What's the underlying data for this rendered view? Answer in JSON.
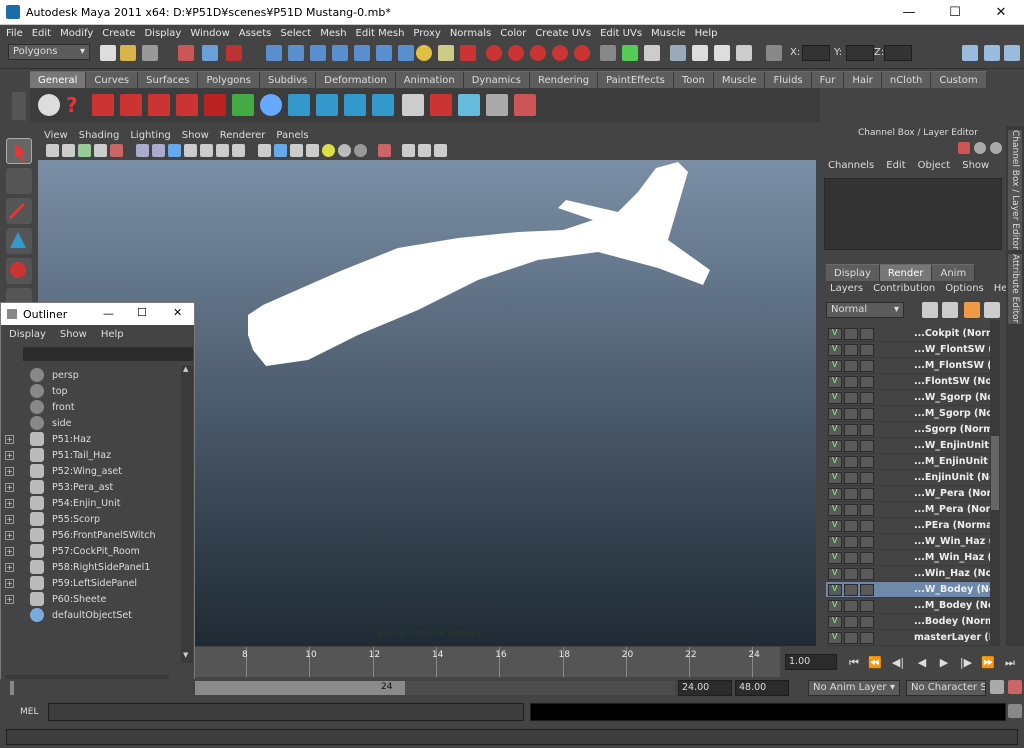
{
  "window": {
    "title": "Autodesk Maya 2011 x64: D:¥P51D¥scenes¥P51D Mustang-0.mb*",
    "minimize": "—",
    "maximize": "☐",
    "close": "✕"
  },
  "menubar": [
    "File",
    "Edit",
    "Modify",
    "Create",
    "Display",
    "Window",
    "Assets",
    "Select",
    "Mesh",
    "Edit Mesh",
    "Proxy",
    "Normals",
    "Color",
    "Create UVs",
    "Edit UVs",
    "Muscle",
    "Help"
  ],
  "statusline": {
    "mode": "Polygons",
    "x_label": "X:",
    "y_label": "Y:",
    "z_label": "Z:"
  },
  "shelf_tabs": [
    "General",
    "Curves",
    "Surfaces",
    "Polygons",
    "Subdivs",
    "Deformation",
    "Animation",
    "Dynamics",
    "Rendering",
    "PaintEffects",
    "Toon",
    "Muscle",
    "Fluids",
    "Fur",
    "Hair",
    "nCloth",
    "Custom"
  ],
  "viewport": {
    "menu": [
      "View",
      "Shading",
      "Lighting",
      "Show",
      "Renderer",
      "Panels"
    ],
    "camera_label": "persp (P51:W_Bodey)"
  },
  "channel_box": {
    "title": "Channel Box / Layer Editor",
    "menu": [
      "Channels",
      "Edit",
      "Object",
      "Show"
    ],
    "layer_tabs": [
      "Display",
      "Render",
      "Anim"
    ],
    "active_layer_tab": "Render",
    "layer_menu": [
      "Layers",
      "Contribution",
      "Options",
      "Help"
    ],
    "blend_mode": "Normal",
    "layers": [
      {
        "name": "...Cokpit (Normal)",
        "selected": false
      },
      {
        "name": "...W_FlontSW (Norm",
        "selected": false
      },
      {
        "name": "...M_FlontSW (Norm",
        "selected": false
      },
      {
        "name": "...FlontSW (Normal)",
        "selected": false
      },
      {
        "name": "...W_Sgorp (Normal)",
        "selected": false
      },
      {
        "name": "...M_Sgorp (Normal)",
        "selected": false
      },
      {
        "name": "...Sgorp (Normal)",
        "selected": false
      },
      {
        "name": "...W_EnjinUnit (Norm",
        "selected": false
      },
      {
        "name": "...M_EnjinUnit (Norm",
        "selected": false
      },
      {
        "name": "...EnjinUnit (Normal)",
        "selected": false
      },
      {
        "name": "...W_Pera (Normal)",
        "selected": false
      },
      {
        "name": "...M_Pera (Normal)",
        "selected": false
      },
      {
        "name": "...PEra (Normal)",
        "selected": false
      },
      {
        "name": "...W_Win_Haz (Norm",
        "selected": false
      },
      {
        "name": "...M_Win_Haz (Norm",
        "selected": false
      },
      {
        "name": "...Win_Haz (Normal)",
        "selected": false
      },
      {
        "name": "...W_Bodey (Normal)",
        "selected": true
      },
      {
        "name": "...M_Bodey (Normal)",
        "selected": false
      },
      {
        "name": "...Bodey (Normal)",
        "selected": false
      },
      {
        "name": "masterLayer (Norma",
        "selected": false
      }
    ],
    "vtabs": [
      "Channel Box / Layer Editor",
      "Attribute Editor"
    ]
  },
  "outliner": {
    "title": "Outliner",
    "menu": [
      "Display",
      "Show",
      "Help"
    ],
    "items": [
      {
        "name": "persp",
        "expandable": false,
        "kind": "camera"
      },
      {
        "name": "top",
        "expandable": false,
        "kind": "camera"
      },
      {
        "name": "front",
        "expandable": false,
        "kind": "camera"
      },
      {
        "name": "side",
        "expandable": false,
        "kind": "camera"
      },
      {
        "name": "P51:Haz",
        "expandable": true,
        "kind": "group"
      },
      {
        "name": "P51:Tail_Haz",
        "expandable": true,
        "kind": "group"
      },
      {
        "name": "P52:Wing_aset",
        "expandable": true,
        "kind": "group"
      },
      {
        "name": "P53:Pera_ast",
        "expandable": true,
        "kind": "group"
      },
      {
        "name": "P54:Enjin_Unit",
        "expandable": true,
        "kind": "group"
      },
      {
        "name": "P55:Scorp",
        "expandable": true,
        "kind": "group"
      },
      {
        "name": "P56:FrontPanelSWitch",
        "expandable": true,
        "kind": "group"
      },
      {
        "name": "P57:CockPit_Room",
        "expandable": true,
        "kind": "group"
      },
      {
        "name": "P58:RightSidePanel1",
        "expandable": true,
        "kind": "group"
      },
      {
        "name": "P59:LeftSidePanel",
        "expandable": true,
        "kind": "group"
      },
      {
        "name": "P60:Sheete",
        "expandable": true,
        "kind": "group"
      },
      {
        "name": "defaultObjectSet",
        "expandable": false,
        "kind": "set"
      }
    ]
  },
  "timeline": {
    "ticks": [
      "8",
      "10",
      "12",
      "14",
      "16",
      "18",
      "20",
      "22",
      "24"
    ],
    "current_time": "1.00"
  },
  "range": {
    "range_end_marker": "24",
    "start": "24.00",
    "end": "48.00",
    "anim_layer": "No Anim Layer",
    "character_set": "No Character Set"
  },
  "cmdline": {
    "label": "MEL"
  }
}
